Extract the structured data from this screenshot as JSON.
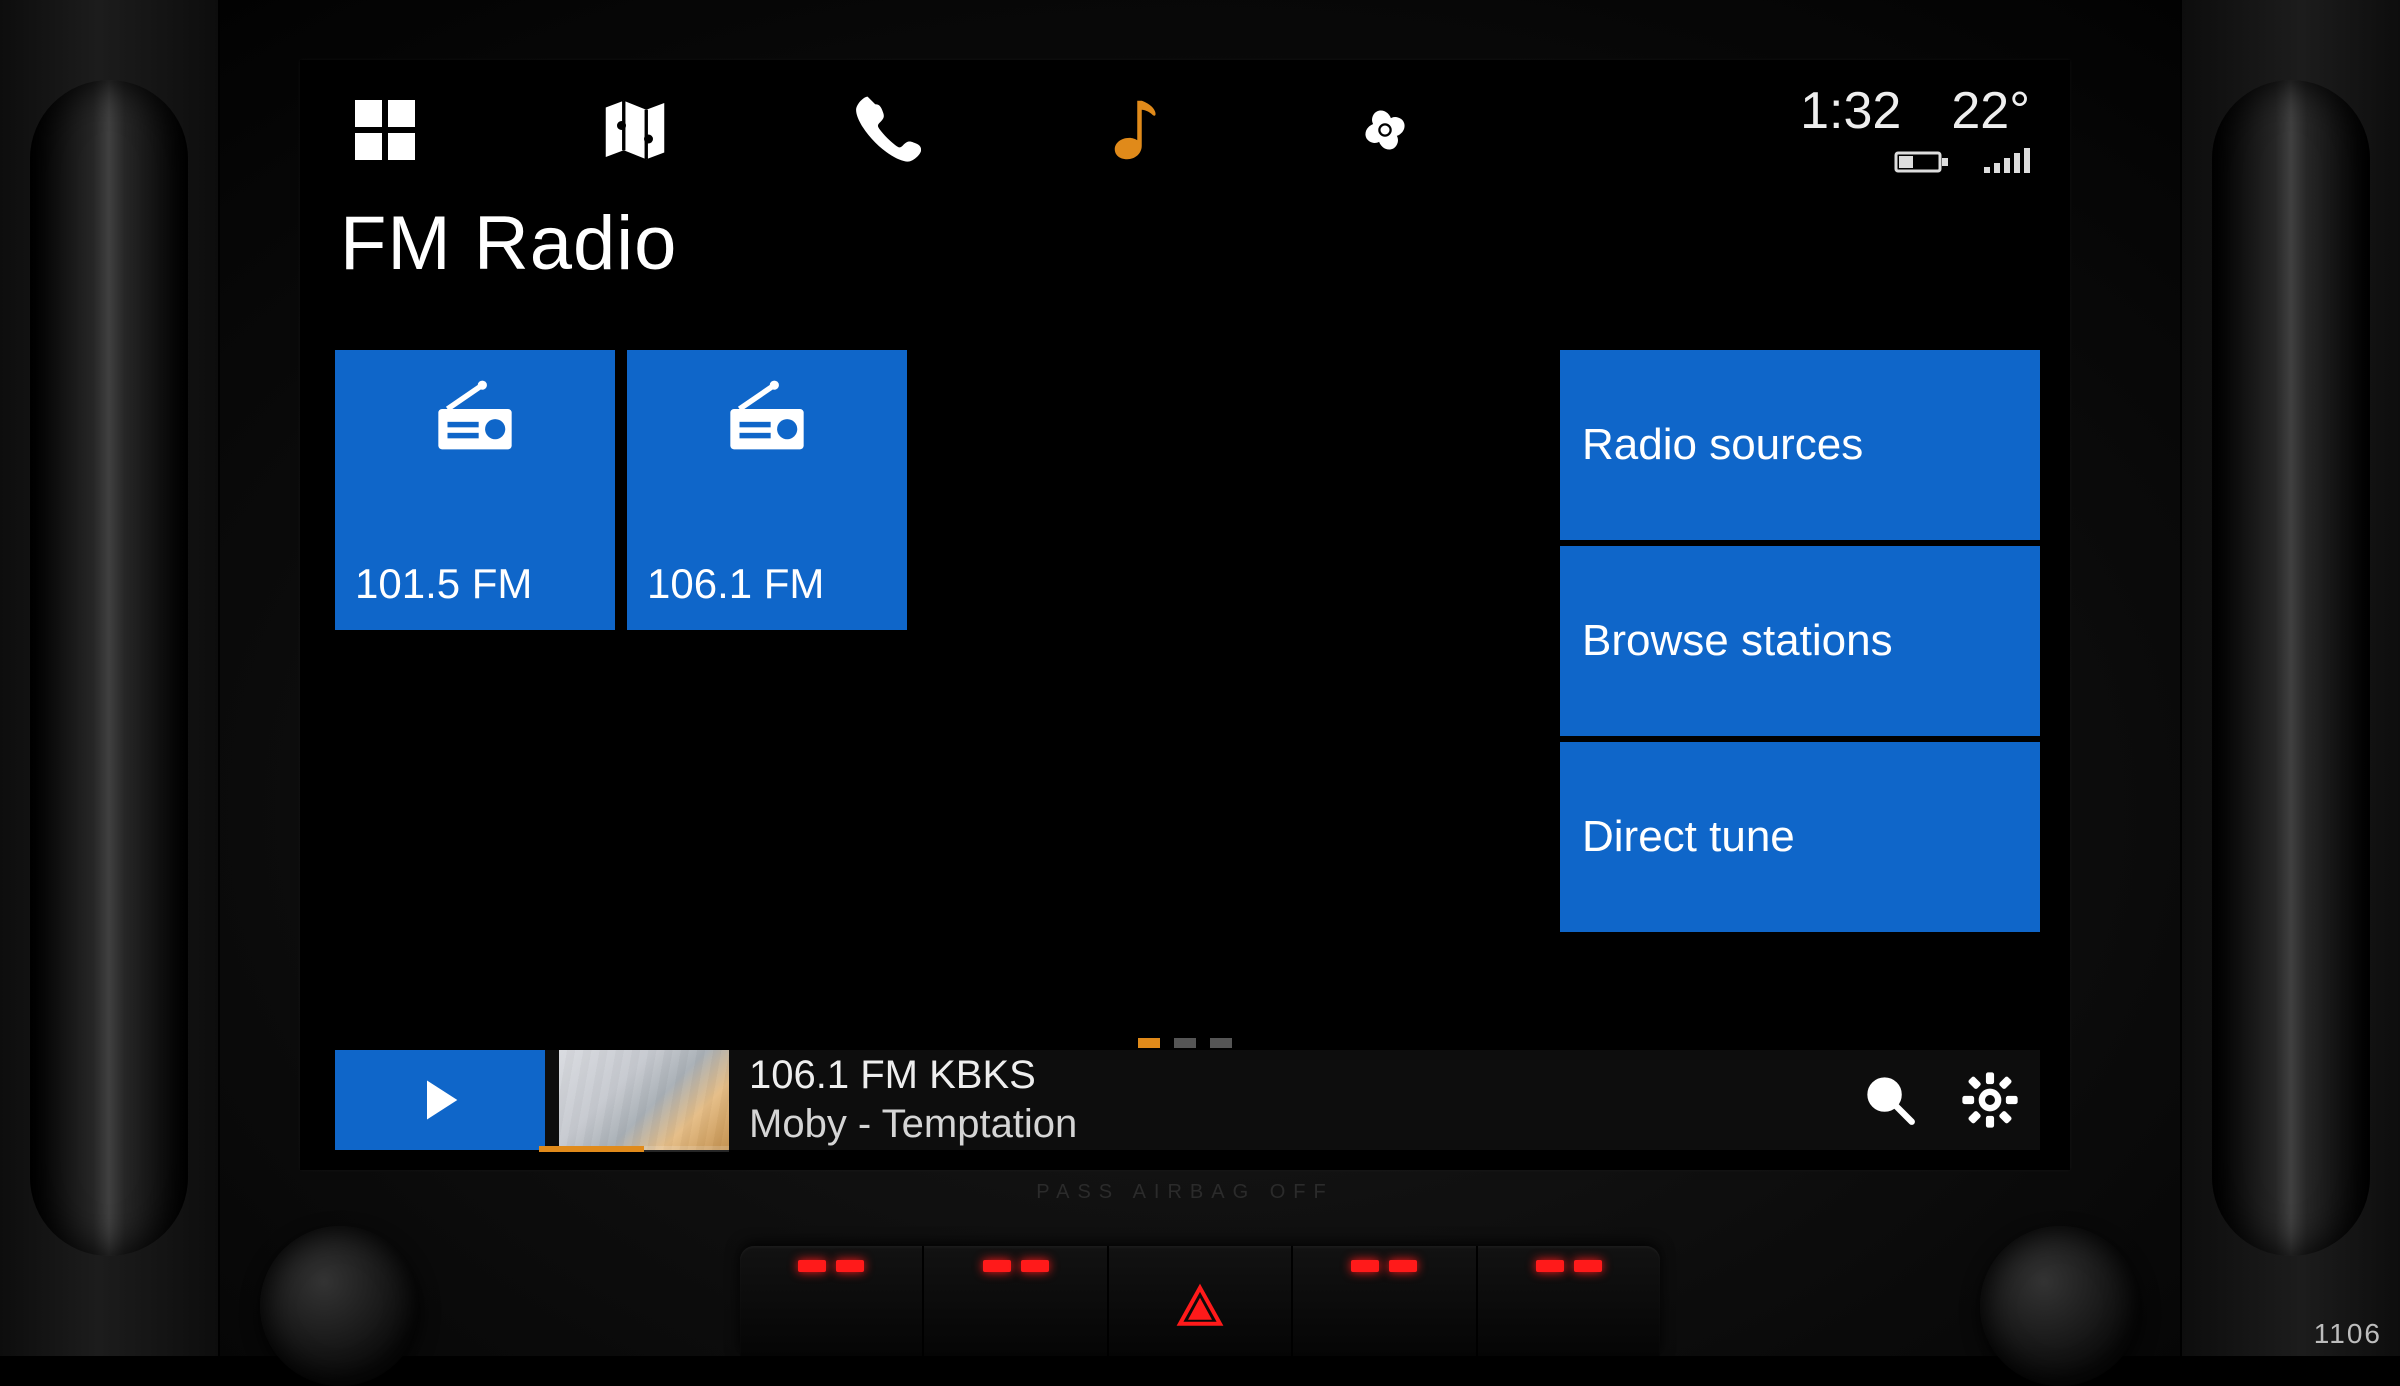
{
  "header": {
    "time": "1:32",
    "temperature": "22°"
  },
  "nav": {
    "active_index": 3,
    "items": [
      "home",
      "maps",
      "phone",
      "music",
      "climate"
    ]
  },
  "page": {
    "title": "FM Radio"
  },
  "presets": [
    {
      "label": "101.5 FM"
    },
    {
      "label": "106.1 FM"
    }
  ],
  "panel": [
    {
      "label": "Radio sources"
    },
    {
      "label": "Browse stations"
    },
    {
      "label": "Direct tune"
    }
  ],
  "pagination": {
    "count": 3,
    "active": 0
  },
  "now_playing": {
    "station": "106.1 FM KBKS",
    "track": "Moby - Temptation"
  },
  "dashboard": {
    "airbag_label": "PASS AIRBAG OFF",
    "code": "1106"
  },
  "colors": {
    "accent_blue": "#0f66c9",
    "accent_orange": "#e08a1a"
  }
}
